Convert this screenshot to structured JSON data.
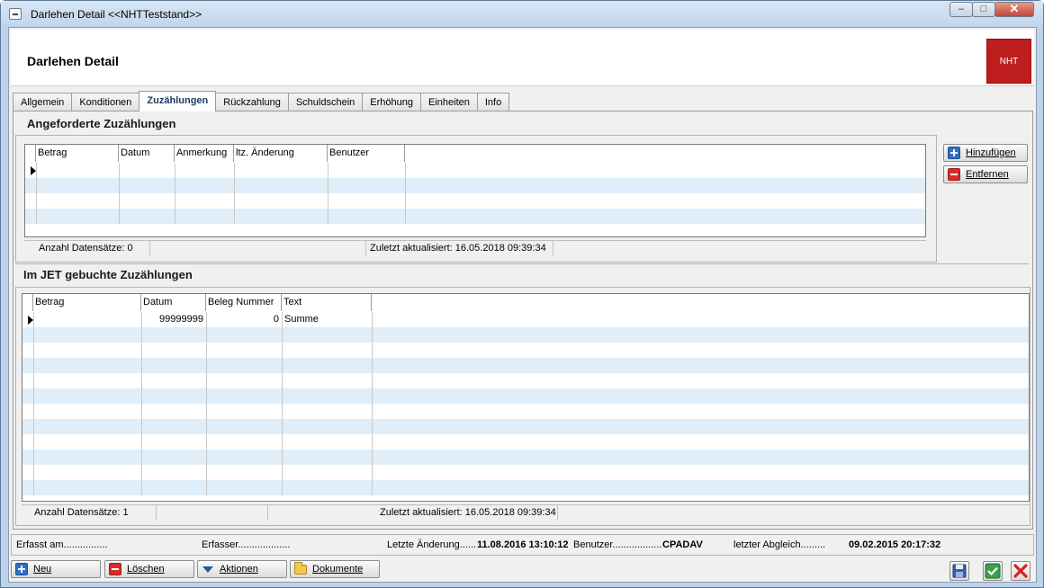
{
  "window": {
    "title": "Darlehen Detail  <<NHTTeststand>>",
    "minimize": "–",
    "maximize": "□",
    "close": "✕"
  },
  "header": {
    "title": "Darlehen Detail",
    "logo_text": "NHT"
  },
  "tabs": [
    {
      "label": "Allgemein"
    },
    {
      "label": "Konditionen"
    },
    {
      "label": "Zuzählungen",
      "active": true
    },
    {
      "label": "Rückzahlung"
    },
    {
      "label": "Schuldschein"
    },
    {
      "label": "Erhöhung"
    },
    {
      "label": "Einheiten"
    },
    {
      "label": "Info"
    }
  ],
  "requested": {
    "title": "Angeforderte Zuzählungen",
    "columns": [
      "Betrag",
      "Datum",
      "Anmerkung",
      "ltz. Änderung",
      "Benutzer"
    ],
    "status_count": "Anzahl Datensätze: 0",
    "status_updated": "Zuletzt aktualisiert: 16.05.2018 09:39:34",
    "add_button": "Hinzufügen",
    "remove_button": "Entfernen"
  },
  "booked": {
    "title": "Im JET gebuchte Zuzählungen",
    "columns": [
      "Betrag",
      "Datum",
      "Beleg Nummer",
      "Text"
    ],
    "row": {
      "betrag": "",
      "datum": "99999999",
      "beleg": "0",
      "text": "Summe"
    },
    "status_count": "Anzahl Datensätze: 1",
    "status_updated": "Zuletzt aktualisiert: 16.05.2018 09:39:34"
  },
  "footer": {
    "erfasst_label": "Erfasst am................",
    "erfasser_label": "Erfasser...................",
    "letzte_label": "Letzte Änderung......",
    "letzte_value": "11.08.2016 13:10:12",
    "benutzer_label": "Benutzer..................",
    "benutzer_value": "CPADAV",
    "abgleich_label": "letzter Abgleich.........",
    "abgleich_value": "09.02.2015 20:17:32"
  },
  "actions": {
    "new": "Neu",
    "delete": "Löschen",
    "actions": "Aktionen",
    "documents": "Dokumente"
  }
}
